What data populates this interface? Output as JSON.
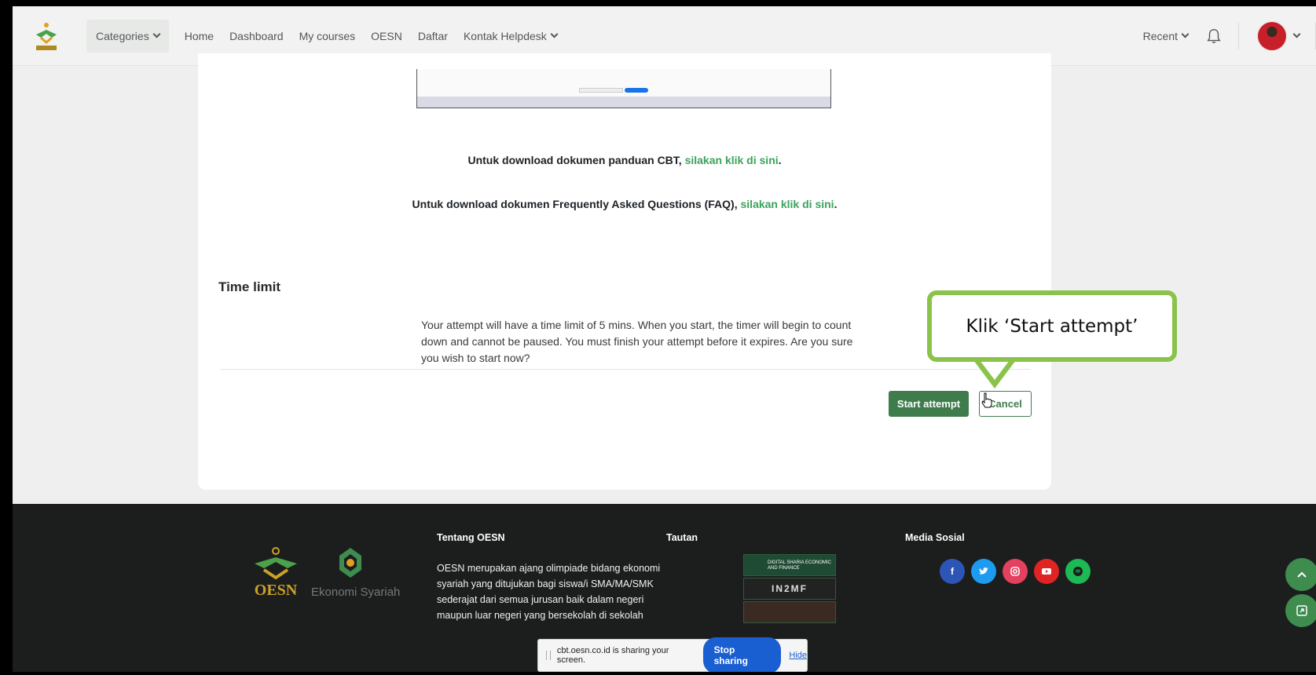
{
  "navbar": {
    "categories_label": "Categories",
    "links": [
      "Home",
      "Dashboard",
      "My courses",
      "OESN",
      "Daftar",
      "Kontak Helpdesk"
    ],
    "recent_label": "Recent"
  },
  "content": {
    "download_cbt_text": "Untuk download dokumen panduan CBT, ",
    "download_cbt_link": "silakan klik di sini",
    "download_faq_text": "Untuk download dokumen Frequently Asked Questions (FAQ), ",
    "download_faq_link": "silakan klik di sini",
    "period": ".",
    "time_limit_title": "Time limit",
    "time_limit_desc": "Your attempt will have a time limit of 5 mins. When you start, the timer will begin to count down and cannot be paused. You must finish your attempt before it expires. Are you sure you wish to start now?",
    "start_button": "Start attempt",
    "cancel_button": "Cancel"
  },
  "callout": {
    "text": "Klik ‘Start attempt’",
    "border_color": "#8bc34a"
  },
  "footer": {
    "logo_text": "OESN",
    "ekonomi_text": "Ekonomi Syariah",
    "about_title": "Tentang OESN",
    "about_text": "OESN merupakan ajang olimpiade bidang ekonomi syariah yang ditujukan bagi siswa/i SMA/MA/SMK sederajat dari semua jurusan baik dalam negeri maupun luar negeri yang bersekolah di sekolah",
    "links_title": "Tautan",
    "tautan_logos": [
      "DIGITAL SHARIA ECONOMIC AND FINANCE",
      "IN2MF"
    ],
    "social_title": "Media Sosial",
    "social_icons": [
      "facebook-icon",
      "twitter-icon",
      "instagram-icon",
      "youtube-icon",
      "spotify-icon"
    ]
  },
  "sharebar": {
    "text": "cbt.oesn.co.id is sharing your screen.",
    "stop_label": "Stop sharing",
    "hide_label": "Hide"
  },
  "colors": {
    "accent_green": "#3f7c4c",
    "link_green": "#3aa35b",
    "footer_bg": "#1c1e1d"
  }
}
